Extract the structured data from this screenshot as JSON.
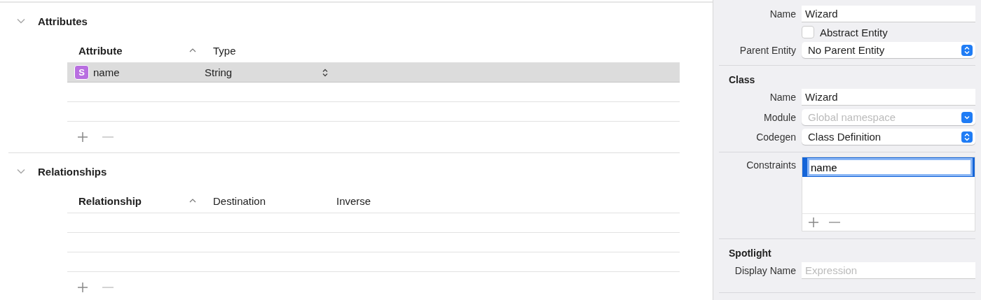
{
  "sections": [
    {
      "title": "Attributes",
      "expanded": true,
      "columns": [
        {
          "label": "Attribute",
          "sorted": true
        },
        {
          "label": "Type",
          "sorted": false
        }
      ],
      "rows": [
        {
          "badge": "S",
          "name": "name",
          "type": "String",
          "selected": true
        }
      ]
    },
    {
      "title": "Relationships",
      "expanded": true,
      "columns": [
        {
          "label": "Relationship",
          "sorted": true
        },
        {
          "label": "Destination",
          "sorted": false
        },
        {
          "label": "Inverse",
          "sorted": false
        }
      ]
    }
  ],
  "inspector": {
    "entity": {
      "name_label": "Name",
      "name_value": "Wizard",
      "abstract": {
        "label": "Abstract Entity",
        "checked": false
      },
      "parent_label": "Parent Entity",
      "parent_value": "No Parent Entity"
    },
    "class": {
      "title": "Class",
      "fields": [
        {
          "kind": "text",
          "label": "Name",
          "value": "Wizard"
        },
        {
          "kind": "dropdown",
          "label": "Module",
          "placeholder": "Global namespace"
        },
        {
          "kind": "popup",
          "label": "Codegen",
          "value": "Class Definition"
        }
      ]
    },
    "constraints": {
      "label": "Constraints",
      "items": [
        {
          "value": "name",
          "selected": true
        }
      ]
    },
    "spotlight": {
      "title": "Spotlight",
      "label": "Display Name",
      "placeholder": "Expression"
    }
  }
}
